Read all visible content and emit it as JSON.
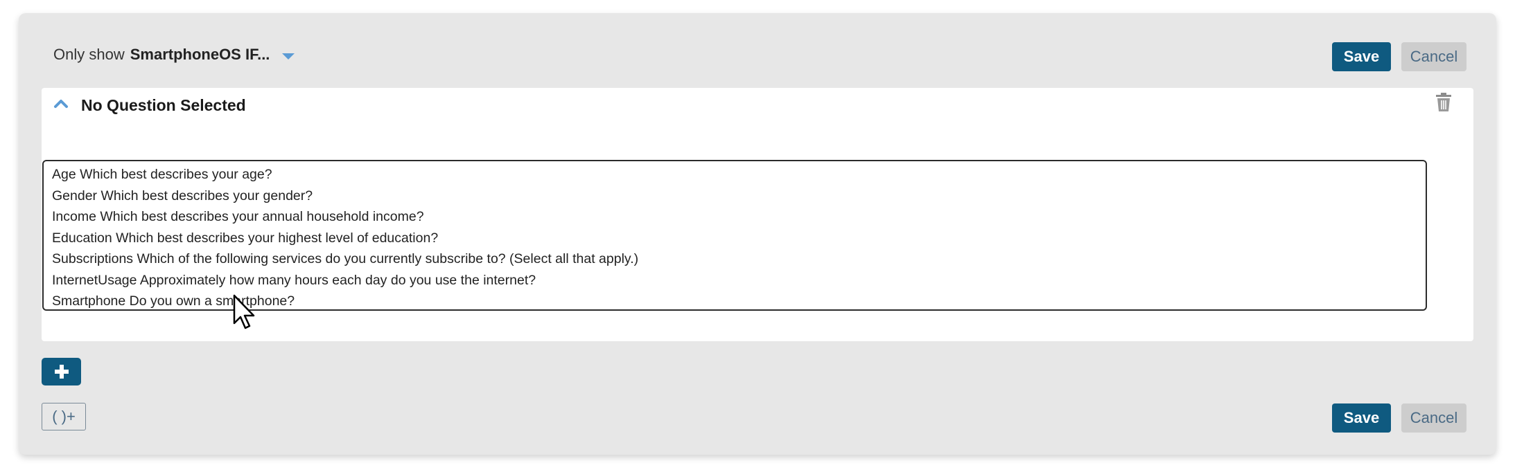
{
  "header": {
    "prefix": "Only show",
    "condition": "SmartphoneOS IF...",
    "dropdown_icon": "caret-down-icon"
  },
  "top_actions": {
    "save_label": "Save",
    "cancel_label": "Cancel"
  },
  "question_card": {
    "title": "No Question Selected",
    "collapse_icon": "chevron-up-icon",
    "delete_icon": "trash-icon",
    "options": [
      "Age Which best describes your age?",
      "Gender Which best describes your gender?",
      "Income Which best describes your annual household income?",
      "Education Which best describes your highest level of education?",
      "Subscriptions Which of the following services do you currently subscribe to? (Select all that apply.)",
      "InternetUsage Approximately how many hours each day do you use the internet?",
      "Smartphone Do you own a smartphone?"
    ]
  },
  "add_button": {
    "icon": "plus-icon"
  },
  "paren_button": {
    "label": "( )+"
  },
  "bottom_actions": {
    "save_label": "Save",
    "cancel_label": "Cancel"
  },
  "colors": {
    "primary": "#0f5a80",
    "panel_bg": "#e7e7e7",
    "cancel_bg": "#cdcdcd",
    "accent_caret": "#5b9bd5"
  }
}
